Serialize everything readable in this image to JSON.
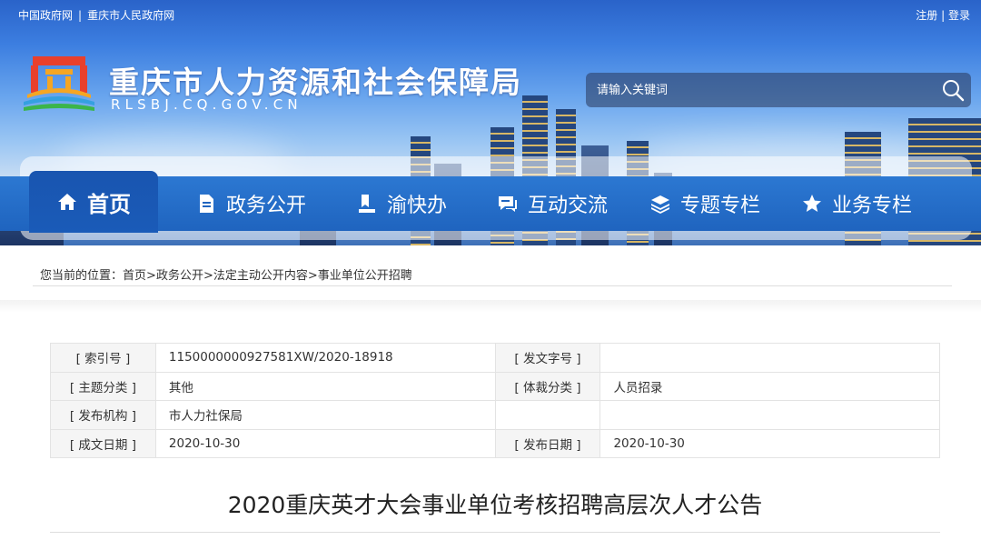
{
  "header": {
    "top_links": [
      "中国政府网",
      "重庆市人民政府网"
    ],
    "top_link_separator": "|",
    "auth": {
      "register": "注册",
      "separator": "|",
      "login": "登录"
    },
    "site_title": "重庆市人力资源和社会保障局",
    "site_domain": "RLSBJ.CQ.GOV.CN",
    "logo_icon": "municipal-emblem-icon"
  },
  "search": {
    "placeholder": "请输入关键词",
    "value": "",
    "icon": "search-icon"
  },
  "nav": {
    "items": [
      {
        "label": "首页",
        "icon": "home-icon",
        "active": true
      },
      {
        "label": "政务公开",
        "icon": "document-icon"
      },
      {
        "label": "渝快办",
        "icon": "bookmark-icon"
      },
      {
        "label": "互动交流",
        "icon": "chat-icon"
      },
      {
        "label": "专题专栏",
        "icon": "layers-icon"
      },
      {
        "label": "业务专栏",
        "icon": "star-icon"
      }
    ]
  },
  "breadcrumb": {
    "prefix": "您当前的位置：",
    "items": [
      "首页",
      "政务公开",
      "法定主动公开内容",
      "事业单位公开招聘"
    ],
    "separator": ">"
  },
  "meta": {
    "index_no_label": "[ 索引号 ]",
    "index_no_value": "11500000009275​81XW/2020-18918",
    "doc_no_label": "[ 发文字号 ]",
    "doc_no_value": "",
    "topic_label": "[ 主题分类 ]",
    "topic_value": "其他",
    "genre_label": "[ 体裁分类 ]",
    "genre_value": "人员招录",
    "publisher_label": "[ 发布机构 ]",
    "publisher_value": "市人力社保局",
    "created_label": "[ 成文日期 ]",
    "created_value": "2020-10-30",
    "published_label": "[ 发布日期 ]",
    "published_value": "2020-10-30"
  },
  "article": {
    "title": "2020重庆英才大会事业单位考核招聘高层次人才公告"
  },
  "colors": {
    "nav_blue": "#1f64bf",
    "nav_active": "#1955b0",
    "text": "#333333"
  }
}
